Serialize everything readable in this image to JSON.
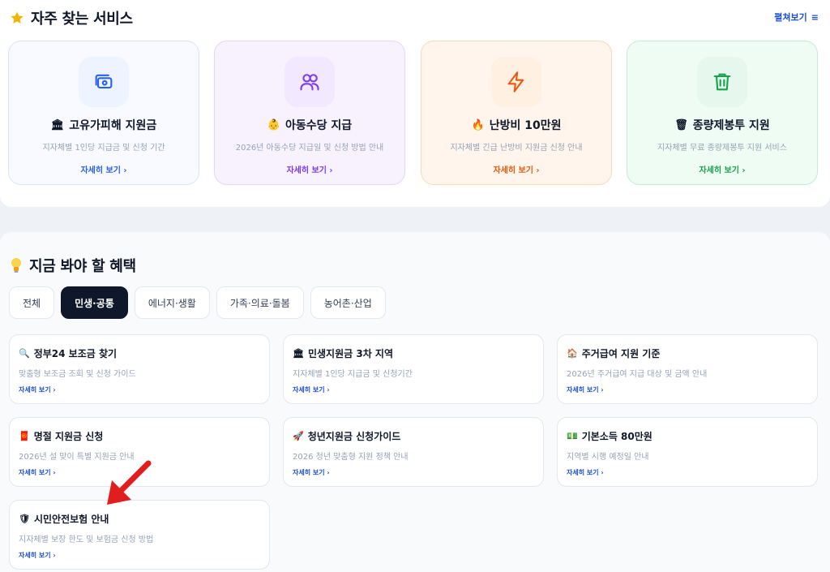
{
  "top": {
    "title": "자주 찾는 서비스",
    "title_icon": "star-icon",
    "expand_label": "펼쳐보기",
    "expand_icon": "menu-icon"
  },
  "services": [
    {
      "emoji": "🏛",
      "title": "고유가피해 지원금",
      "desc": "지자체별 1인당 지급금 및 신청 기간",
      "more": "자세히 보기 ›",
      "icon": "money-icon",
      "accent": "#2563eb",
      "bg": "#f8faff",
      "border": "#dbe3f3",
      "icon_bg": "#eef4ff"
    },
    {
      "emoji": "👶",
      "title": "아동수당 지급",
      "desc": "2026년 아동수당 지급일 및 신청 방법 안내",
      "more": "자세히 보기 ›",
      "icon": "users-icon",
      "accent": "#7c3aed",
      "bg": "#f8f2ff",
      "border": "#e4d5fb",
      "icon_bg": "#f2e8ff"
    },
    {
      "emoji": "🔥",
      "title": "난방비 10만원",
      "desc": "지자체별 긴급 난방비 지원금 신청 안내",
      "more": "자세히 보기 ›",
      "icon": "lightning-icon",
      "accent": "#ea580c",
      "bg": "#fff5ec",
      "border": "#fbd9b8",
      "icon_bg": "#fff0e2"
    },
    {
      "emoji": "🗑",
      "title": "종량제봉투 지원",
      "desc": "지자체별 무료 종량제봉투 지원 서비스",
      "more": "자세히 보기 ›",
      "icon": "trash-icon",
      "accent": "#16a34a",
      "bg": "#effcf3",
      "border": "#c5ecd3",
      "icon_bg": "#e6f8ed"
    }
  ],
  "benefits": {
    "title": "지금 봐야 할 혜택",
    "title_icon": "lightbulb-icon",
    "tabs": [
      "전체",
      "민생·공통",
      "에너지·생활",
      "가족·의료·돌봄",
      "농어촌·산업"
    ],
    "active_tab": "민생·공통",
    "cards": [
      {
        "emoji": "🔍",
        "title": "정부24 보조금 찾기",
        "desc": "맞춤형 보조금 조회 및 신청 가이드",
        "more": "자세히 보기 ›"
      },
      {
        "emoji": "🏛",
        "title": "민생지원금 3차 지역",
        "desc": "지자체별 1인당 지급금 및 신청기간",
        "more": "자세히 보기 ›"
      },
      {
        "emoji": "🏠",
        "title": "주거급여 지원 기준",
        "desc": "2026년 주거급여 지급 대상 및 금액 안내",
        "more": "자세히 보기 ›"
      },
      {
        "emoji": "🧧",
        "title": "명절 지원금 신청",
        "desc": "2026년 설 맞이 특별 지원금 안내",
        "more": "자세히 보기 ›"
      },
      {
        "emoji": "🚀",
        "title": "청년지원금 신청가이드",
        "desc": "2026 청년 맞춤형 지원 정책 안내",
        "more": "자세히 보기 ›"
      },
      {
        "emoji": "💵",
        "title": "기본소득 80만원",
        "desc": "지역별 시행 예정일 안내",
        "more": "자세히 보기 ›"
      },
      {
        "emoji": "🛡",
        "title": "시민안전보험 안내",
        "desc": "지자체별 보장 한도 및 보험금 신청 방법",
        "more": "자세히 보기 ›"
      }
    ]
  },
  "annotation": {
    "icon": "red-arrow-icon",
    "color": "#e11d1d"
  }
}
